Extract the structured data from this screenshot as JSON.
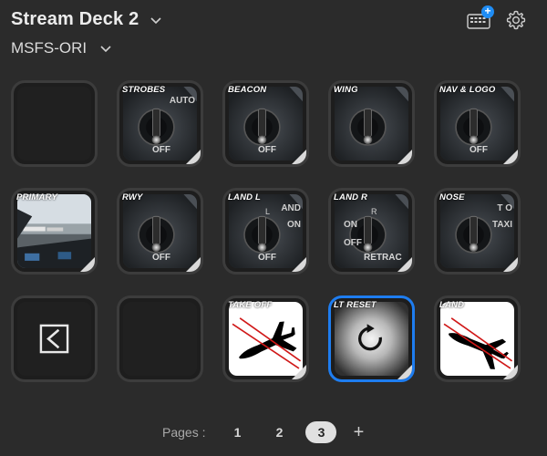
{
  "header": {
    "device_title": "Stream Deck 2",
    "profile_name": "MSFS-ORI",
    "add_badge": "+"
  },
  "keys": [
    {
      "label": "",
      "kind": "empty"
    },
    {
      "label": "STROBES",
      "kind": "switch",
      "sub": "OFF",
      "side": "AUTO"
    },
    {
      "label": "BEACON",
      "kind": "switch",
      "sub": "OFF"
    },
    {
      "label": "WING",
      "kind": "switch",
      "sub": ""
    },
    {
      "label": "NAV & LOGO",
      "kind": "switch",
      "sub": "OFF"
    },
    {
      "label": "PRIMARY",
      "kind": "photo"
    },
    {
      "label": "RWY",
      "kind": "switch",
      "sub": "OFF"
    },
    {
      "label": "LAND L",
      "kind": "switch",
      "sub": "OFF",
      "side": "AND",
      "mid": "ON",
      "top": "L"
    },
    {
      "label": "LAND R",
      "kind": "switch",
      "sub": "RETRAC",
      "mid": "ON",
      "side2": "OFF",
      "top": "R"
    },
    {
      "label": "NOSE",
      "kind": "switch",
      "sub": "",
      "side": "T O",
      "mid": "TAXI"
    },
    {
      "label": "",
      "kind": "back"
    },
    {
      "label": "",
      "kind": "empty"
    },
    {
      "label": "TAKE OFF",
      "kind": "plane-up"
    },
    {
      "label": "LT RESET",
      "kind": "reset"
    },
    {
      "label": "LAND",
      "kind": "plane-down"
    }
  ],
  "pages": {
    "label": "Pages :",
    "items": [
      "1",
      "2",
      "3"
    ],
    "active": "3",
    "add": "+"
  }
}
